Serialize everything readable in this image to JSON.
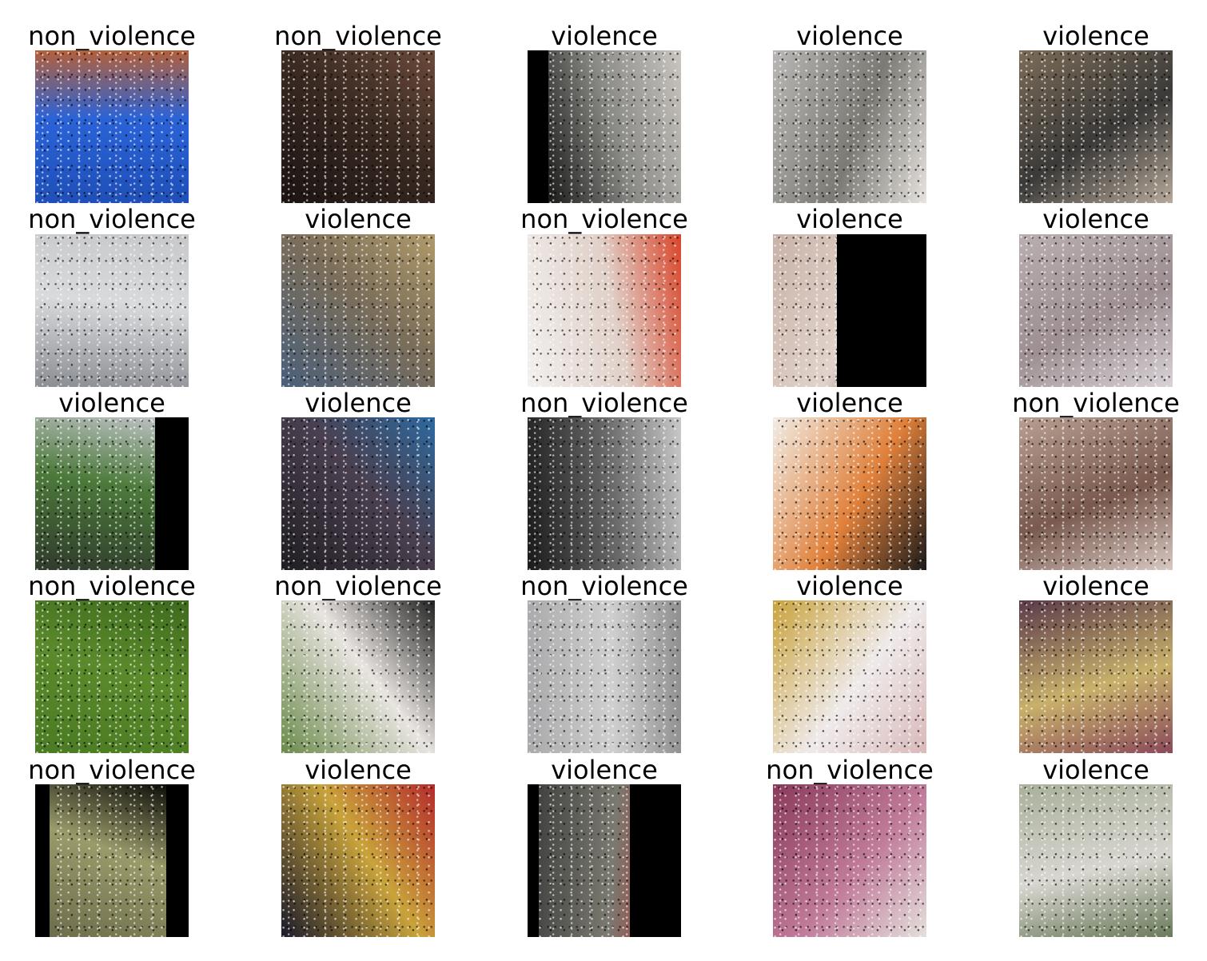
{
  "grid": {
    "rows": [
      [
        {
          "label": "non_violence",
          "colors": [
            "#1f4fb8",
            "#2a63d8",
            "#b4603a"
          ]
        },
        {
          "label": "non_violence",
          "colors": [
            "#1b1412",
            "#3a2a22",
            "#6b4a3a"
          ]
        },
        {
          "label": "violence",
          "colors": [
            "#000000",
            "#8a8a86",
            "#c9c5c0"
          ]
        },
        {
          "label": "violence",
          "colors": [
            "#b9b7b5",
            "#7c7a74",
            "#e7e4e0"
          ]
        },
        {
          "label": "violence",
          "colors": [
            "#7c6c58",
            "#3b3a38",
            "#b7a99a"
          ]
        }
      ],
      [
        {
          "label": "non_violence",
          "colors": [
            "#8a8d92",
            "#d9dadc",
            "#c7c8ca"
          ]
        },
        {
          "label": "violence",
          "colors": [
            "#4a5f7a",
            "#7b6e5a",
            "#b09a6a"
          ]
        },
        {
          "label": "non_violence",
          "colors": [
            "#f2f0ee",
            "#e0d0c8",
            "#d9452a"
          ]
        },
        {
          "label": "violence",
          "colors": [
            "#c9b2a8",
            "#e1d3cb",
            "#000000"
          ]
        },
        {
          "label": "violence",
          "colors": [
            "#b9aeb0",
            "#9d8f92",
            "#d9d2d6"
          ]
        }
      ],
      [
        {
          "label": "violence",
          "colors": [
            "#2f3a2c",
            "#4c7a3a",
            "#c4c6cc"
          ]
        },
        {
          "label": "violence",
          "colors": [
            "#1f1d22",
            "#4a3f4f",
            "#2c6aa0"
          ]
        },
        {
          "label": "non_violence",
          "colors": [
            "#1a1a1a",
            "#6a6a6a",
            "#c9c9c9"
          ]
        },
        {
          "label": "violence",
          "colors": [
            "#f1ece4",
            "#e0803a",
            "#1a1a1a"
          ]
        },
        {
          "label": "non_violence",
          "colors": [
            "#b89f92",
            "#7a5a4e",
            "#d8c9c2"
          ]
        }
      ],
      [
        {
          "label": "non_violence",
          "colors": [
            "#4a7a22",
            "#5b8a2c",
            "#3d6a1c"
          ]
        },
        {
          "label": "non_violence",
          "colors": [
            "#6a8a4a",
            "#e8e4e0",
            "#222222"
          ]
        },
        {
          "label": "non_violence",
          "colors": [
            "#a9a9ab",
            "#cfcfcf",
            "#8f8f90"
          ]
        },
        {
          "label": "violence",
          "colors": [
            "#c9a23a",
            "#efeaea",
            "#d9b9b9"
          ]
        },
        {
          "label": "violence",
          "colors": [
            "#5a3a4a",
            "#c8b06a",
            "#8a4a5a"
          ]
        }
      ],
      [
        {
          "label": "non_violence",
          "colors": [
            "#6a6a4a",
            "#9a9a6a",
            "#000000"
          ]
        },
        {
          "label": "violence",
          "colors": [
            "#1a1a2a",
            "#c9a33a",
            "#b52b2b"
          ]
        },
        {
          "label": "violence",
          "colors": [
            "#3a3a3a",
            "#7a7a70",
            "#c02020"
          ]
        },
        {
          "label": "non_violence",
          "colors": [
            "#8a3a5a",
            "#c07a9a",
            "#e5e0dc"
          ]
        },
        {
          "label": "violence",
          "colors": [
            "#a8b09a",
            "#d8d6d0",
            "#6a7a5a"
          ]
        }
      ]
    ]
  }
}
